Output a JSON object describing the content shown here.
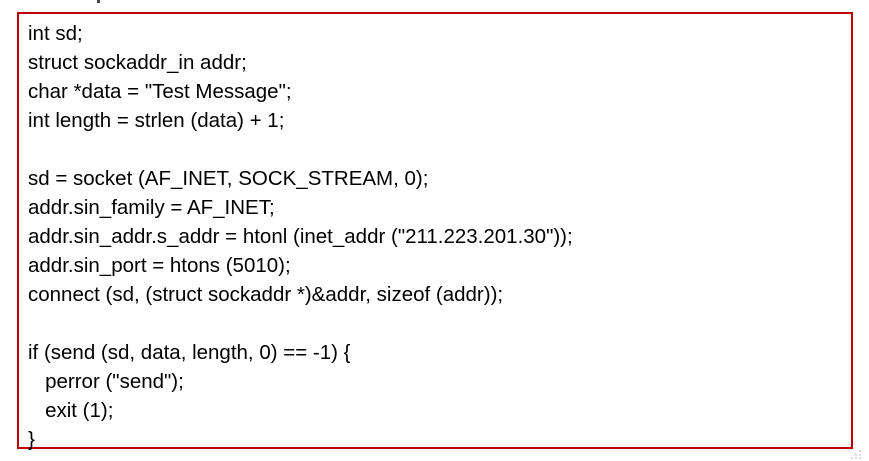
{
  "code": {
    "lines": [
      "int sd;",
      "struct sockaddr_in addr;",
      "char *data = \"Test Message\";",
      "int length = strlen (data) + 1;",
      "",
      "sd = socket (AF_INET, SOCK_STREAM, 0);",
      "addr.sin_family = AF_INET;",
      "addr.sin_addr.s_addr = htonl (inet_addr (\"211.223.201.30\"));",
      "addr.sin_port = htons (5010);",
      "connect (sd, (struct sockaddr *)&addr, sizeof (addr));",
      "",
      "if (send (sd, data, length, 0) == -1) {",
      "   perror (\"send\");",
      "   exit (1);",
      "}"
    ]
  },
  "colors": {
    "border": "#c00000",
    "text": "#000000",
    "background": "#ffffff"
  },
  "icons": {
    "resize_grip": "resize-grip-icon"
  }
}
